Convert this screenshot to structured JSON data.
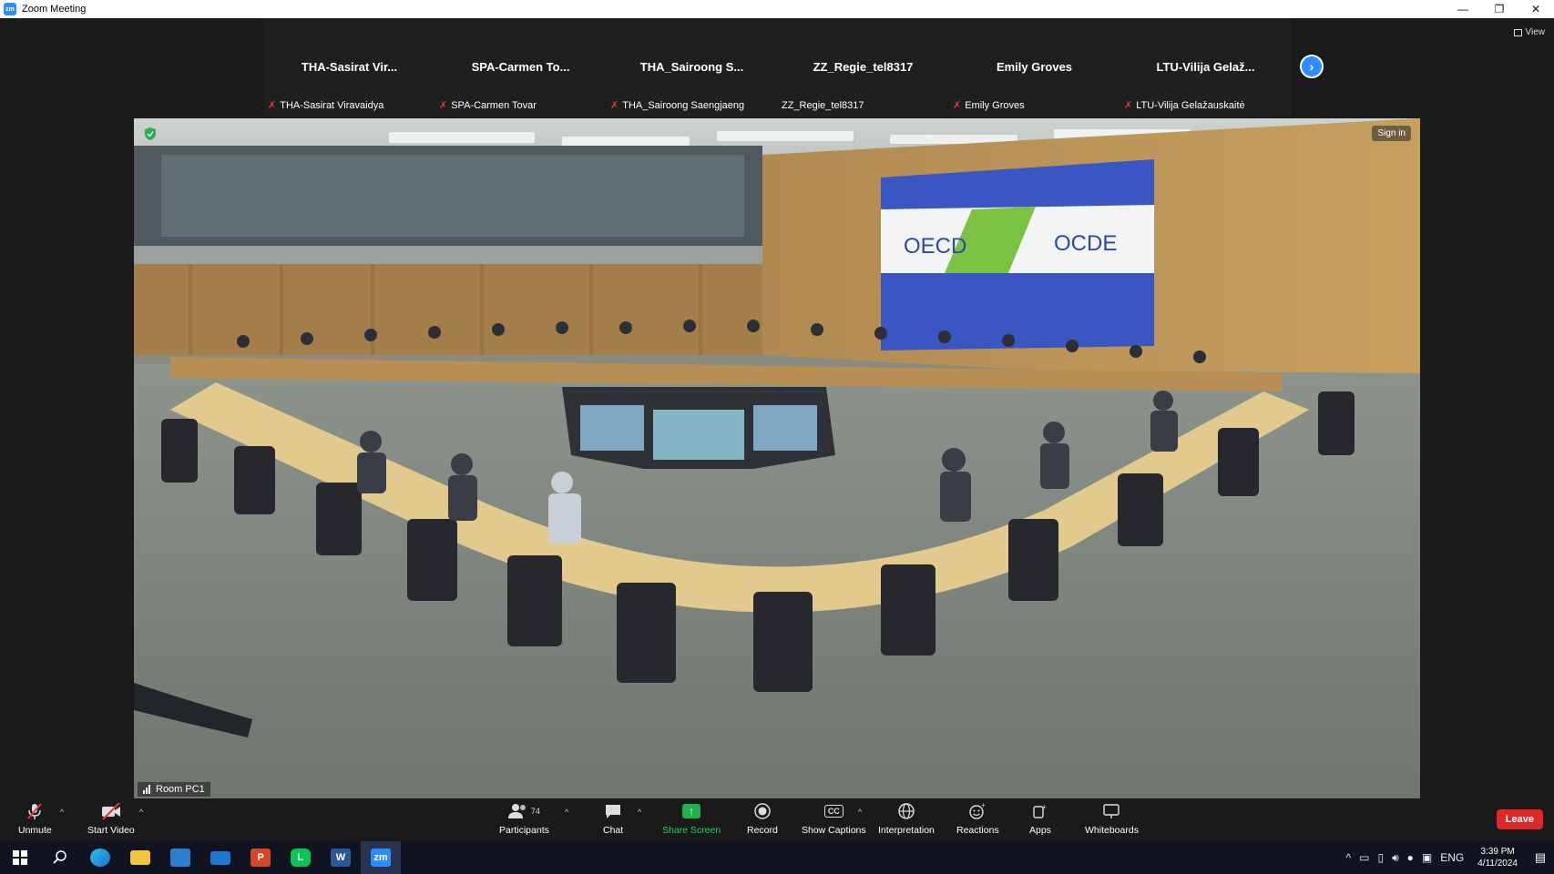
{
  "window": {
    "title": "Zoom Meeting",
    "logo_text": "zm"
  },
  "window_controls": {
    "minimize": "—",
    "restore": "❐",
    "close": "✕"
  },
  "view_button": {
    "label": "View"
  },
  "participants": [
    {
      "name": "THA-Sasirat Vir...",
      "label": "THA-Sasirat Viravaidya",
      "muted": true
    },
    {
      "name": "SPA-Carmen To...",
      "label": "SPA-Carmen Tovar",
      "muted": true
    },
    {
      "name": "THA_Sairoong S...",
      "label": "THA_Sairoong Saengjaeng",
      "muted": true
    },
    {
      "name": "ZZ_Regie_tel8317",
      "label": "ZZ_Regie_tel8317",
      "muted": false
    },
    {
      "name": "Emily Groves",
      "label": "Emily Groves",
      "muted": true
    },
    {
      "name": "LTU-Vilija Gelaž...",
      "label": "LTU-Vilija Gelažauskaitė",
      "muted": true
    }
  ],
  "main_video": {
    "sign_in": "Sign in",
    "room_label": "Room PC1",
    "banner_left": "OECD",
    "banner_right": "OCDE"
  },
  "toolbar": {
    "unmute": "Unmute",
    "start_video": "Start Video",
    "participants": "Participants",
    "participants_count": "74",
    "chat": "Chat",
    "share_screen": "Share Screen",
    "record": "Record",
    "show_captions": "Show Captions",
    "captions_icon": "CC",
    "interpretation": "Interpretation",
    "reactions": "Reactions",
    "apps": "Apps",
    "whiteboards": "Whiteboards",
    "leave": "Leave"
  },
  "taskbar": {
    "apps": [
      "windows-start",
      "search",
      "edge",
      "file-explorer",
      "store",
      "mail",
      "powerpoint",
      "line",
      "word",
      "zoom"
    ],
    "powerpoint_letter": "P",
    "word_letter": "W",
    "zoom_letter": "zm",
    "line_letter": "L",
    "language": "ENG",
    "time": "3:39 PM",
    "date": "4/11/2024"
  },
  "colors": {
    "zoom_blue": "#2d8cff",
    "share_green": "#23b14d",
    "leave_red": "#e02828",
    "muted_red": "#e0383e"
  }
}
